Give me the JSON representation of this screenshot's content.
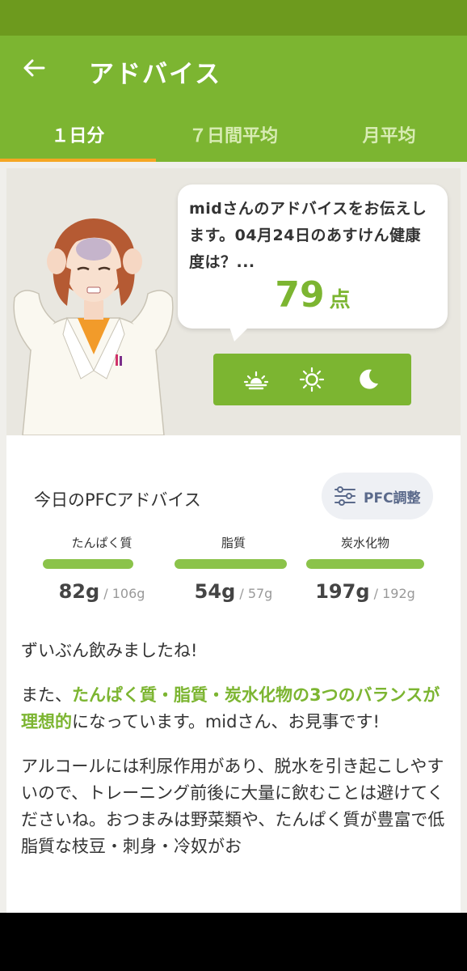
{
  "appbar": {
    "title": "アドバイス",
    "back_icon": "arrow-left-icon"
  },
  "tabs": [
    {
      "label": "１日分",
      "active": true
    },
    {
      "label": "７日間平均",
      "active": false
    },
    {
      "label": "月平均",
      "active": false
    }
  ],
  "bubble": {
    "message": "midさんのアドバイスをお伝えします。04月24日のあすけん健康度は？...",
    "score": "79",
    "score_unit": "点"
  },
  "timebar": {
    "icons": [
      "sunrise-icon",
      "sun-icon",
      "moon-icon"
    ]
  },
  "pfc": {
    "title": "今日のPFCアドバイス",
    "adjust_button": "PFC調整",
    "items": [
      {
        "label": "たんぱく質",
        "value": "82",
        "unit": "g",
        "target": "/ 106g",
        "fill": 0.77
      },
      {
        "label": "脂質",
        "value": "54",
        "unit": "g",
        "target": "/ 57g",
        "fill": 0.95
      },
      {
        "label": "炭水化物",
        "value": "197",
        "unit": "g",
        "target": "/ 192g",
        "fill": 1.0
      }
    ]
  },
  "advice": {
    "p1": "ずいぶん飲みましたね!",
    "p2_pre": "また、",
    "p2_highlight": "たんぱく質・脂質・炭水化物の3つのバランスが理想的",
    "p2_post": "になっています。midさん、お見事です!",
    "p3": "アルコールには利尿作用があり、脱水を引き起こしやすいので、トレーニング前後に大量に飲むことは避けてくださいね。おつまみは野菜類や、たんぱく質が豊富で低脂質な枝豆・刺身・冷奴がお"
  },
  "colors": {
    "primary": "#7cb531",
    "statusbar": "#6d9a1e",
    "accent_indicator": "#f5a623",
    "bar": "#8bc34a"
  }
}
